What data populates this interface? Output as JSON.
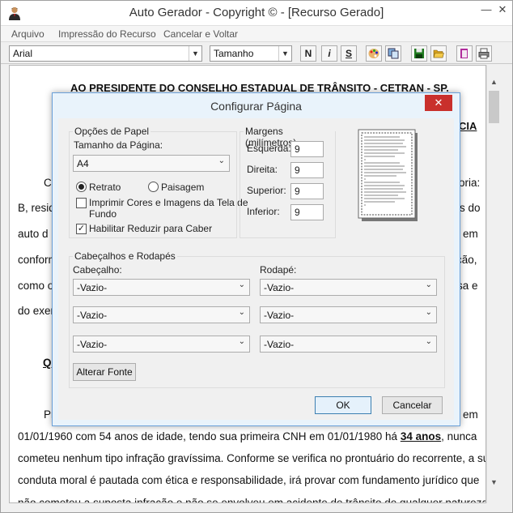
{
  "window": {
    "title": "Auto Gerador - Copyright © - [Recurso Gerado]",
    "minimize": "—",
    "close": "✕"
  },
  "menu": [
    "Arquivo",
    "Impressão do Recurso",
    "Cancelar e Voltar"
  ],
  "toolbar": {
    "font": "Arial",
    "size": "Tamanho",
    "bold": "N",
    "italic": "i",
    "underline": "S"
  },
  "document": {
    "heading": "AO PRESIDENTE DO CONSELHO ESTADUAL DE TRÂNSITO - CETRAN - SP.",
    "right_fragment": "CIA",
    "lines": [
      {
        "left": "Co",
        "right": "oria:"
      },
      {
        "left": "B, resid",
        "right": "s do"
      },
      {
        "left": "auto d",
        "right": "em"
      },
      {
        "left": "conform",
        "right": "ção,"
      },
      {
        "left": "como o",
        "right": "sa e"
      },
      {
        "left": "do exer",
        "right": ""
      }
    ],
    "q_fragment": "QU",
    "pr_fragment": "Pr",
    "em_fragment": "em",
    "para1_a": "01/01/1960 com 54 anos de idade, tendo sua primeira CNH em 01/01/1980 há ",
    "para1_b": "34 anos",
    "para1_c": ", nunca",
    "para2": "cometeu nenhum tipo infração gravíssima. Conforme se verifica no prontuário do recorrente, a sua",
    "para3": "conduta moral é pautada com ética e responsabilidade, irá provar com fundamento jurídico que",
    "para4": "não cometeu a suposta infração e não se envolveu em acidente de trânsito de qualquer natureza"
  },
  "dialog": {
    "title": "Configurar Página",
    "close": "✕",
    "paper": {
      "legend": "Opções de Papel",
      "size_label": "Tamanho da Página:",
      "size_value": "A4",
      "portrait": "Retrato",
      "landscape": "Paisagem",
      "print_colors": "Imprimir Cores e Imagens da Tela de",
      "print_colors2": "Fundo",
      "shrink": "Habilitar Reduzir para Caber",
      "portrait_selected": true,
      "print_colors_checked": false,
      "shrink_checked": true
    },
    "margins": {
      "legend": "Margens (milímetros)",
      "left_label": "Esquerda:",
      "left": "9",
      "right_label": "Direita:",
      "right": "9",
      "top_label": "Superior:",
      "top": "9",
      "bottom_label": "Inferior:",
      "bottom": "9"
    },
    "headers": {
      "legend": "Cabeçalhos e Rodapés",
      "header_label": "Cabeçalho:",
      "footer_label": "Rodapé:",
      "header_values": [
        "-Vazio-",
        "-Vazio-",
        "-Vazio-"
      ],
      "footer_values": [
        "-Vazio-",
        "-Vazio-",
        "-Vazio-"
      ],
      "font_button": "Alterar Fonte"
    },
    "ok": "OK",
    "cancel": "Cancelar"
  }
}
